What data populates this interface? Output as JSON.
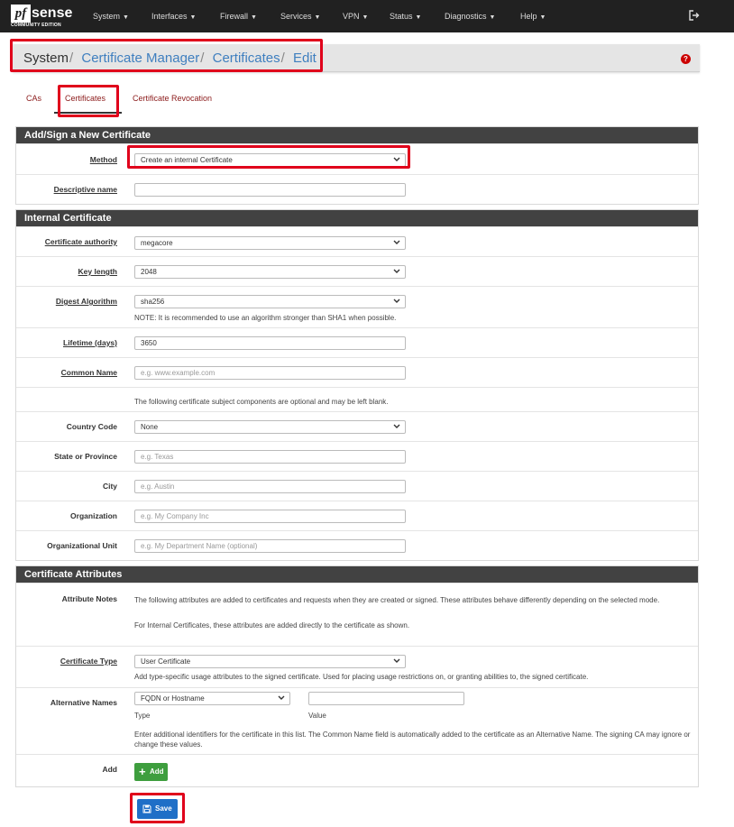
{
  "brand": {
    "logo_pf": "pf",
    "logo_sense": "sense",
    "edition": "COMMUNITY EDITION"
  },
  "nav": [
    "System",
    "Interfaces",
    "Firewall",
    "Services",
    "VPN",
    "Status",
    "Diagnostics",
    "Help"
  ],
  "breadcrumb": {
    "root": "System",
    "items": [
      "Certificate Manager",
      "Certificates",
      "Edit"
    ]
  },
  "tabs": [
    "CAs",
    "Certificates",
    "Certificate Revocation"
  ],
  "active_tab": "Certificates",
  "sections": {
    "add": {
      "title": "Add/Sign a New Certificate",
      "method_label": "Method",
      "method_value": "Create an internal Certificate",
      "descr_label": "Descriptive name",
      "descr_value": ""
    },
    "internal": {
      "title": "Internal Certificate",
      "ca_label": "Certificate authority",
      "ca_value": "megacore",
      "keylen_label": "Key length",
      "keylen_value": "2048",
      "digest_label": "Digest Algorithm",
      "digest_value": "sha256",
      "digest_note": "NOTE: It is recommended to use an algorithm stronger than SHA1 when possible.",
      "lifetime_label": "Lifetime (days)",
      "lifetime_value": "3650",
      "cn_label": "Common Name",
      "cn_placeholder": "e.g. www.example.com",
      "optional_note": "The following certificate subject components are optional and may be left blank.",
      "country_label": "Country Code",
      "country_value": "None",
      "state_label": "State or Province",
      "state_placeholder": "e.g. Texas",
      "city_label": "City",
      "city_placeholder": "e.g. Austin",
      "org_label": "Organization",
      "org_placeholder": "e.g. My Company Inc",
      "ou_label": "Organizational Unit",
      "ou_placeholder": "e.g. My Department Name (optional)"
    },
    "attributes": {
      "title": "Certificate Attributes",
      "notes_label": "Attribute Notes",
      "notes_text1": "The following attributes are added to certificates and requests when they are created or signed. These attributes behave differently depending on the selected mode.",
      "notes_text2": "For Internal Certificates, these attributes are added directly to the certificate as shown.",
      "type_label": "Certificate Type",
      "type_value": "User Certificate",
      "type_note": "Add type-specific usage attributes to the signed certificate. Used for placing usage restrictions on, or granting abilities to, the signed certificate.",
      "alt_label": "Alternative Names",
      "alt_type_value": "FQDN or Hostname",
      "alt_type_caption": "Type",
      "alt_value_caption": "Value",
      "alt_note": "Enter additional identifiers for the certificate in this list. The Common Name field is automatically added to the certificate as an Alternative Name. The signing CA may ignore or change these values.",
      "add_label": "Add",
      "add_button": "Add"
    }
  },
  "save_button": "Save",
  "colors": {
    "navbar": "#212121",
    "panel_header": "#424242",
    "link": "#3f7fbf",
    "tab_text": "#8b1a1a",
    "add_button": "#3e9e3e",
    "save_button": "#1f6fc7",
    "highlight": "#e0001b"
  }
}
